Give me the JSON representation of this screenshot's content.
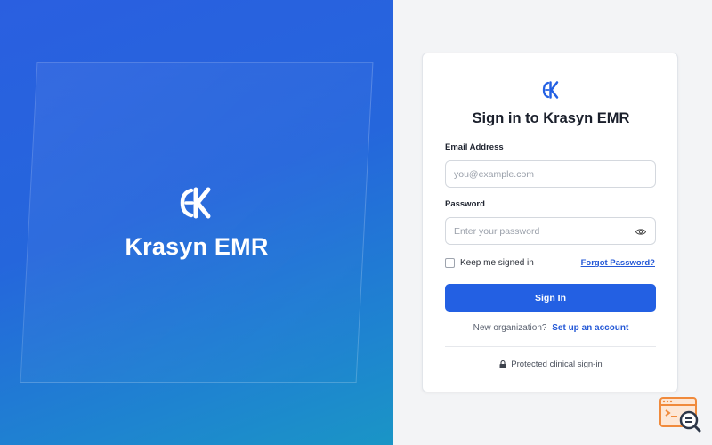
{
  "brand": {
    "logo_text": "EK",
    "name": "Krasyn EMR"
  },
  "login": {
    "title": "Sign in to Krasyn EMR",
    "email_label": "Email Address",
    "email_placeholder": "you@example.com",
    "email_value": "",
    "password_label": "Password",
    "password_placeholder": "Enter your password",
    "password_value": "",
    "remember_label": "Keep me signed in",
    "remember_checked": false,
    "forgot_label": "Forgot Password?",
    "submit_label": "Sign In",
    "new_org_text": "New organization?",
    "setup_link": "Set up an account",
    "protected_text": "Protected clinical sign-in"
  },
  "icons": {
    "logo": "ek-logo-icon",
    "show_password": "eye-icon",
    "secure": "lock-icon",
    "help": "help-search-icon"
  },
  "colors": {
    "brand_gradient_start": "#2a5fe0",
    "brand_gradient_end": "#1a95c6",
    "primary": "#2360e3",
    "link": "#2458d6",
    "widget_accent": "#f08a3c"
  }
}
